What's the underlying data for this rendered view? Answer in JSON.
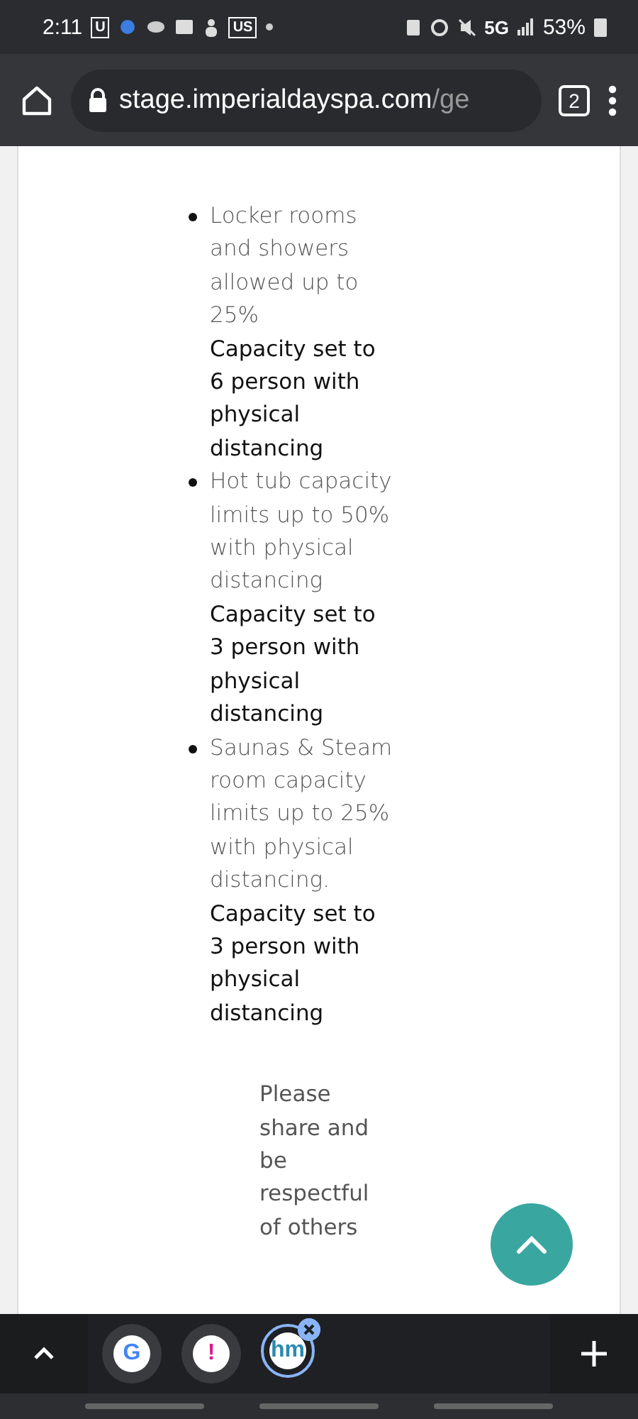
{
  "status_bar": {
    "time": "2:11",
    "badges": [
      "U",
      "US"
    ],
    "network": "5G",
    "battery": "53%"
  },
  "browser": {
    "host": "stage.imperialdayspa.com",
    "path": "/ge",
    "tab_count": "2"
  },
  "list": [
    {
      "note": "Locker rooms and showers allowed up to 25%",
      "capacity": "Capacity set to 6 person with physical distancing"
    },
    {
      "note": "Hot tub capacity limits up to 50% with physical distancing",
      "capacity": "Capacity set to 3 person with physical distancing"
    },
    {
      "note": "Saunas & Steam room capacity limits up to 25% with physical distancing.",
      "capacity": "Capacity set to 3 person with physical distancing"
    }
  ],
  "closing": "Please share and be respectful of others",
  "tab_strip": [
    {
      "label": "G",
      "selected": false
    },
    {
      "label": "!",
      "selected": false
    },
    {
      "label": "hm",
      "selected": true
    }
  ]
}
